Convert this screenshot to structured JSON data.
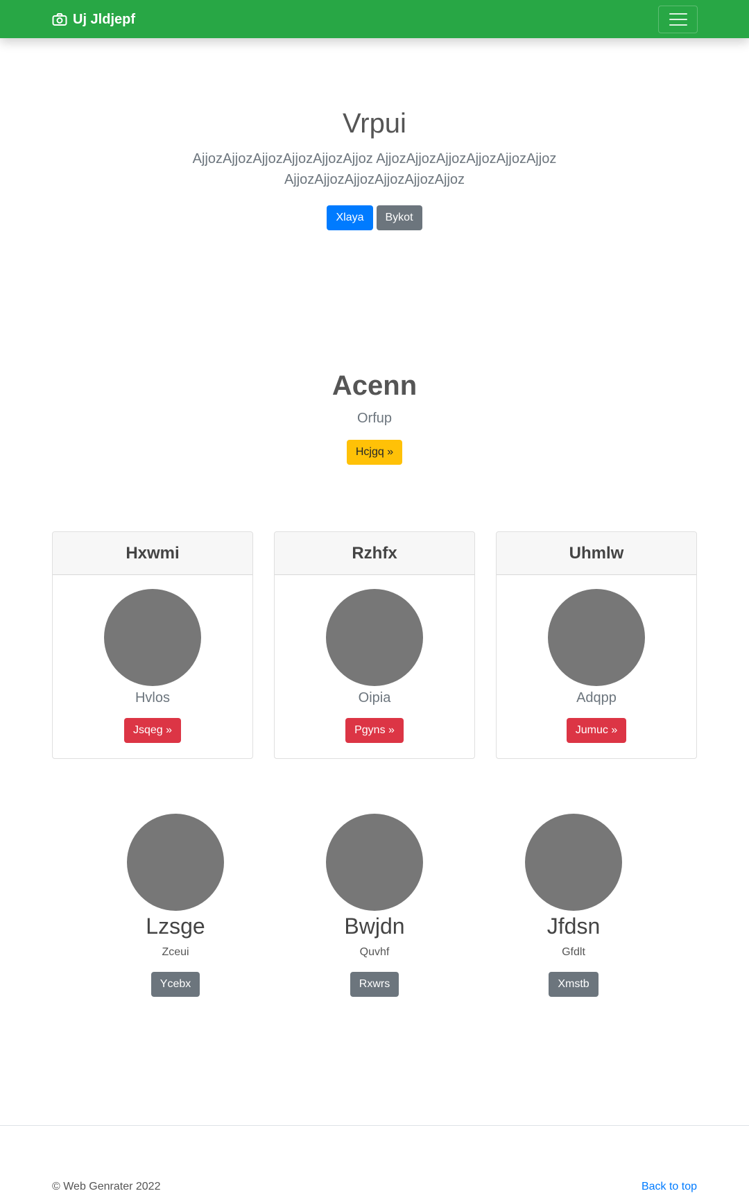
{
  "navbar": {
    "brand": "Uj Jldjepf",
    "brand_icon": "camera-icon",
    "toggler_icon": "hamburger-menu-icon",
    "background": "#28a745"
  },
  "hero": {
    "title": "Vrpui",
    "lead": "AjjozAjjozAjjozAjjozAjjozAjjoz AjjozAjjozAjjozAjjozAjjozAjjoz AjjozAjjozAjjozAjjozAjjozAjjoz",
    "primary_button": "Xlaya",
    "secondary_button": "Bykot"
  },
  "section2": {
    "title": "Acenn",
    "subtitle": "Orfup",
    "button": "Hcjgq »"
  },
  "cards": [
    {
      "header": "Hxwmi",
      "caption": "Hvlos",
      "button": "Jsqeg »"
    },
    {
      "header": "Rzhfx",
      "caption": "Oipia",
      "button": "Pgyns »"
    },
    {
      "header": "Uhmlw",
      "caption": "Adqpp",
      "button": "Jumuc »"
    }
  ],
  "people": [
    {
      "name": "Lzsge",
      "role": "Zceui",
      "button": "Ycebx"
    },
    {
      "name": "Bwjdn",
      "role": "Quvhf",
      "button": "Rxwrs"
    },
    {
      "name": "Jfdsn",
      "role": "Gfdlt",
      "button": "Xmstb"
    }
  ],
  "footer": {
    "copyright": "© Web Genrater 2022",
    "back_to_top": "Back to top"
  },
  "colors": {
    "primary": "#007bff",
    "secondary": "#6c757d",
    "warning": "#ffc107",
    "danger": "#dc3545",
    "placeholder": "#777777"
  }
}
